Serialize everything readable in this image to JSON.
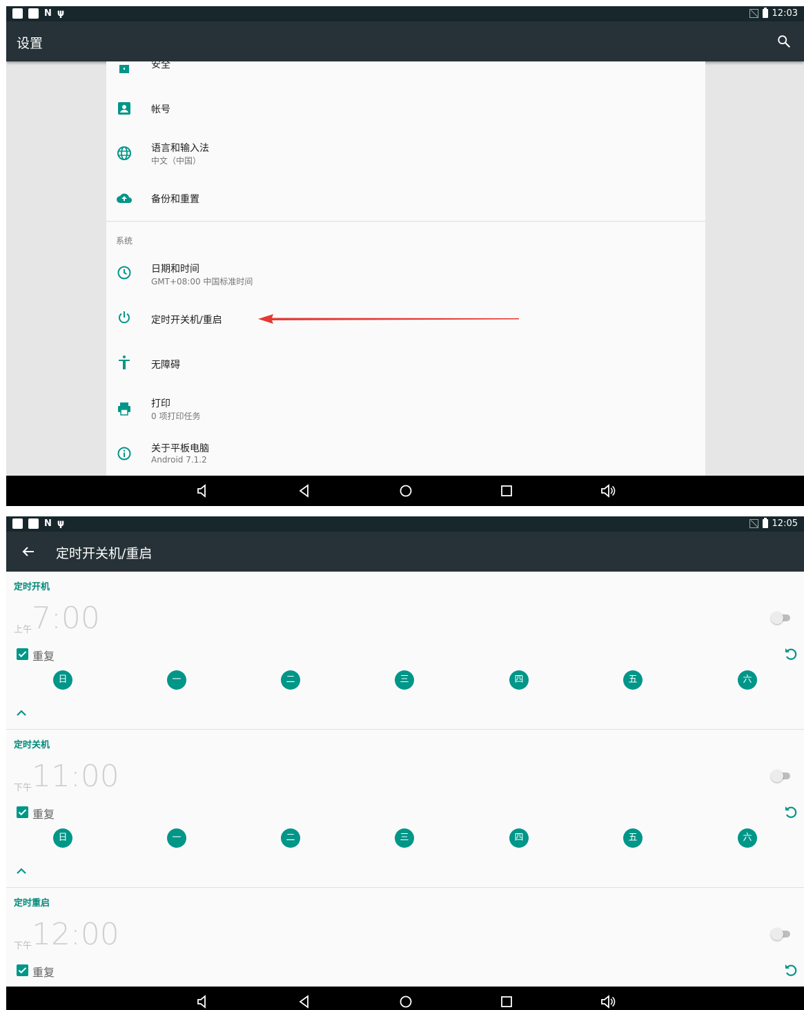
{
  "screen1": {
    "status": {
      "time": "12:03"
    },
    "appbar": {
      "title": "设置",
      "search_icon": "search-icon"
    },
    "items": [
      {
        "title": "安全"
      },
      {
        "title": "帐号"
      },
      {
        "title": "语言和输入法",
        "subtitle": "中文（中国）"
      },
      {
        "title": "备份和重置"
      }
    ],
    "section": "系统",
    "system_items": [
      {
        "title": "日期和时间",
        "subtitle": "GMT+08:00 中国标准时间"
      },
      {
        "title": "定时开关机/重启"
      },
      {
        "title": "无障碍"
      },
      {
        "title": "打印",
        "subtitle": "0 项打印任务"
      },
      {
        "title": "关于平板电脑",
        "subtitle": "Android 7.1.2"
      }
    ]
  },
  "screen2": {
    "status": {
      "time": "12:05"
    },
    "appbar": {
      "title": "定时开关机/重启"
    },
    "repeat_label": "重复",
    "days": [
      "日",
      "一",
      "二",
      "三",
      "四",
      "五",
      "六"
    ],
    "timers": [
      {
        "label": "定时开机",
        "ampm": "上午",
        "time": "7:00",
        "enabled": false,
        "repeat": true
      },
      {
        "label": "定时关机",
        "ampm": "下午",
        "time": "11:00",
        "enabled": false,
        "repeat": true
      },
      {
        "label": "定时重启",
        "ampm": "下午",
        "time": "12:00",
        "enabled": false,
        "repeat": true
      }
    ]
  },
  "colors": {
    "accent": "#009688",
    "appbar": "#263238",
    "statusbar": "#18272c",
    "annotation_arrow": "#e53935"
  }
}
